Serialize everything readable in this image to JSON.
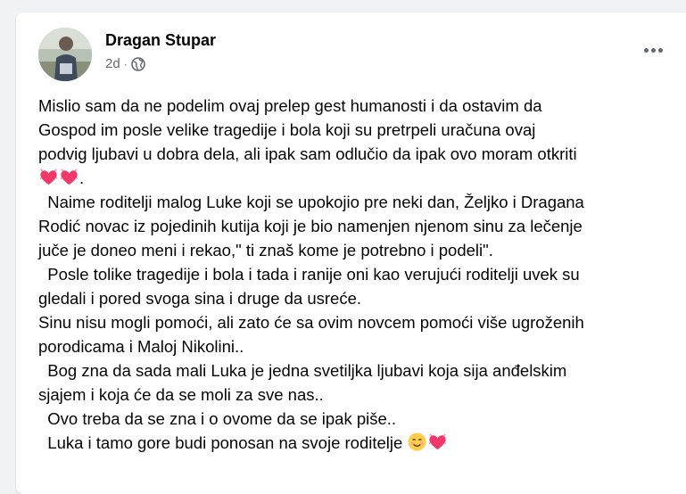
{
  "post": {
    "author": "Dragan Stupar",
    "timestamp": "2d",
    "separator": "·",
    "visibility_icon": "globe-icon",
    "lines": [
      "Mislio sam da ne podelim ovaj prelep gest humanosti i da ostavim da",
      "Gospod im posle velike tragedije i bola koji su pretrpeli uračuna ovaj",
      "podvig ljubavi u dobra dela, ali ipak sam odlučio da ipak ovo moram otkriti",
      ".",
      "  Naime roditelji malog Luke koji se upokojio pre neki dan, Željko i Dragana",
      "Rodić novac iz pojedinih kutija koji je bio namenjen njenom sinu za lečenje",
      "juče je doneo meni i rekao,\" ti znaš kome je potrebno i podeli\".",
      "  Posle tolike tragedije i bola i tada i ranije oni kao verujući roditelji uvek su",
      "gledali i pored svoga sina i druge da usreće.",
      "Sinu nisu mogli pomoći, ali zato će sa ovim novcem pomoći više ugroženih",
      "porodicama i Maloj Nikolini..",
      "  Bog zna da sada mali Luka je jedna svetiljka ljubavi koja sija anđelskim",
      "sjajem i koja će da se moli za sve nas..",
      "  Ovo treba da se zna i o ovome da se ipak piše..",
      "  Luka i tamo gore budi ponosan na svoje roditelje "
    ]
  },
  "icons": {
    "menu": "more-horizontal-icon",
    "heart_emoji": "growing-heart-emoji-icon",
    "smile_emoji": "smiling-face-emoji-icon"
  },
  "colors": {
    "text": "#050505",
    "secondary_text": "#65676b",
    "heart": "#f0396a",
    "background": "#f0f2f5"
  }
}
